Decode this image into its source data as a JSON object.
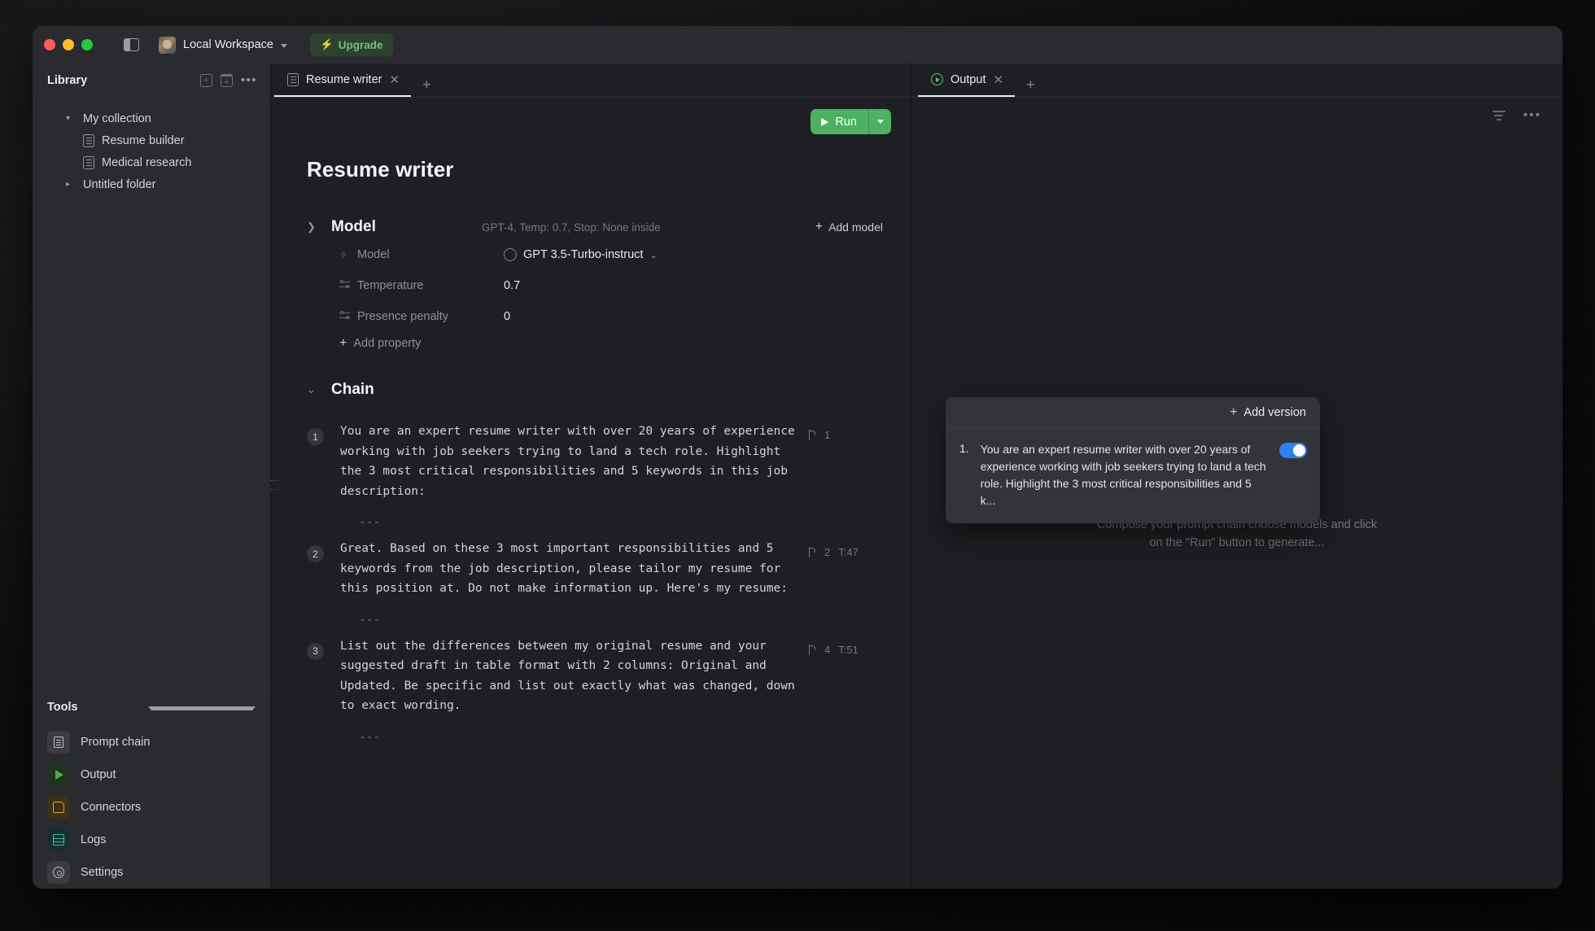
{
  "titlebar": {
    "workspace": "Local Workspace",
    "upgrade_label": "Upgrade",
    "upgrade_icon": "bolt-icon",
    "panel_toggle_icon": "sidebar-toggle-icon"
  },
  "sidebar": {
    "title": "Library",
    "new_file_icon": "new-file-icon",
    "new_folder_icon": "new-folder-icon",
    "more_icon": "more-horizontal-icon",
    "tree": [
      {
        "label": "My collection",
        "type": "group",
        "expanded": true
      },
      {
        "label": "Resume builder",
        "type": "doc"
      },
      {
        "label": "Medical research",
        "type": "doc"
      },
      {
        "label": "Untitled folder",
        "type": "group",
        "expanded": false
      }
    ],
    "tools_title": "Tools",
    "tools": [
      {
        "label": "Prompt chain",
        "icon": "document-icon",
        "color": "#b9bcc1"
      },
      {
        "label": "Output",
        "icon": "play-icon",
        "color": "#4caf50"
      },
      {
        "label": "Connectors",
        "icon": "connector-icon",
        "color": "#d9a441"
      },
      {
        "label": "Logs",
        "icon": "table-icon",
        "color": "#3dbfb0"
      },
      {
        "label": "Settings",
        "icon": "gear-icon",
        "color": "#b9bcc1"
      }
    ]
  },
  "editor": {
    "tab_label": "Resume writer",
    "tab_icon": "document-icon",
    "tab_close_icon": "close-icon",
    "new_tab_icon": "plus-icon",
    "run_label": "Run",
    "run_icon": "play-icon",
    "run_dropdown_icon": "chevron-down-icon",
    "doc_title": "Resume writer",
    "model_section": {
      "name": "Model",
      "summary": "GPT-4, Temp: 0.7, Stop: None inside",
      "collapsed": true,
      "twisty_icon": "chevron-right-icon",
      "add_model_label": "Add model",
      "add_model_icon": "plus-icon",
      "properties": [
        {
          "label": "Model",
          "value": "GPT 3.5-Turbo-instruct",
          "icon": "sparkle-icon",
          "has_brand_icon": true,
          "has_chevron": true
        },
        {
          "label": "Temperature",
          "value": "0.7",
          "icon": "slider-icon"
        },
        {
          "label": "Presence penalty",
          "value": "0",
          "icon": "slider-icon"
        }
      ],
      "add_property_label": "Add property",
      "add_property_icon": "plus-icon"
    },
    "chain_section": {
      "name": "Chain",
      "collapsed": false,
      "twisty_icon": "chevron-down-icon",
      "blocks": [
        {
          "number": "1",
          "text": "You are an expert resume writer with over 20 years of experience working with job seekers trying to land a tech role. Highlight the 3 most critical responsibilities and 5 keywords in this job description:",
          "versions": "1",
          "tokens": "",
          "separator": "---"
        },
        {
          "number": "2",
          "text": "Great. Based on these 3 most important responsibilities and 5 keywords from the job description, please tailor my resume for this position at. Do not make information up. Here's my resume:",
          "versions": "2",
          "tokens": "T:47",
          "separator": "---"
        },
        {
          "number": "3",
          "text": "List out the differences between my original resume and your suggested draft in table format with 2 columns: Original and Updated. Be specific and list out exactly what was changed, down to exact wording.",
          "versions": "4",
          "tokens": "T:51",
          "separator": "---"
        }
      ]
    }
  },
  "output": {
    "tab_label": "Output",
    "tab_icon": "play-circle-icon",
    "tab_close_icon": "close-icon",
    "new_tab_icon": "plus-icon",
    "filter_icon": "filter-icon",
    "more_icon": "more-horizontal-icon",
    "empty_icon": "sparkles-icon",
    "empty_glyph": "✦",
    "empty_text": "Compose your prompt chain choose models and click on the \"Run\" button to generate..."
  },
  "popover": {
    "add_version_label": "Add version",
    "add_version_icon": "plus-icon",
    "items": [
      {
        "index": "1.",
        "text": "You are an expert resume writer with over 20 years of experience working with job seekers trying to land a tech role. Highlight the 3 most critical responsibilities and 5 k...",
        "enabled": true
      }
    ],
    "toggle_color": "#2f7ff0"
  }
}
